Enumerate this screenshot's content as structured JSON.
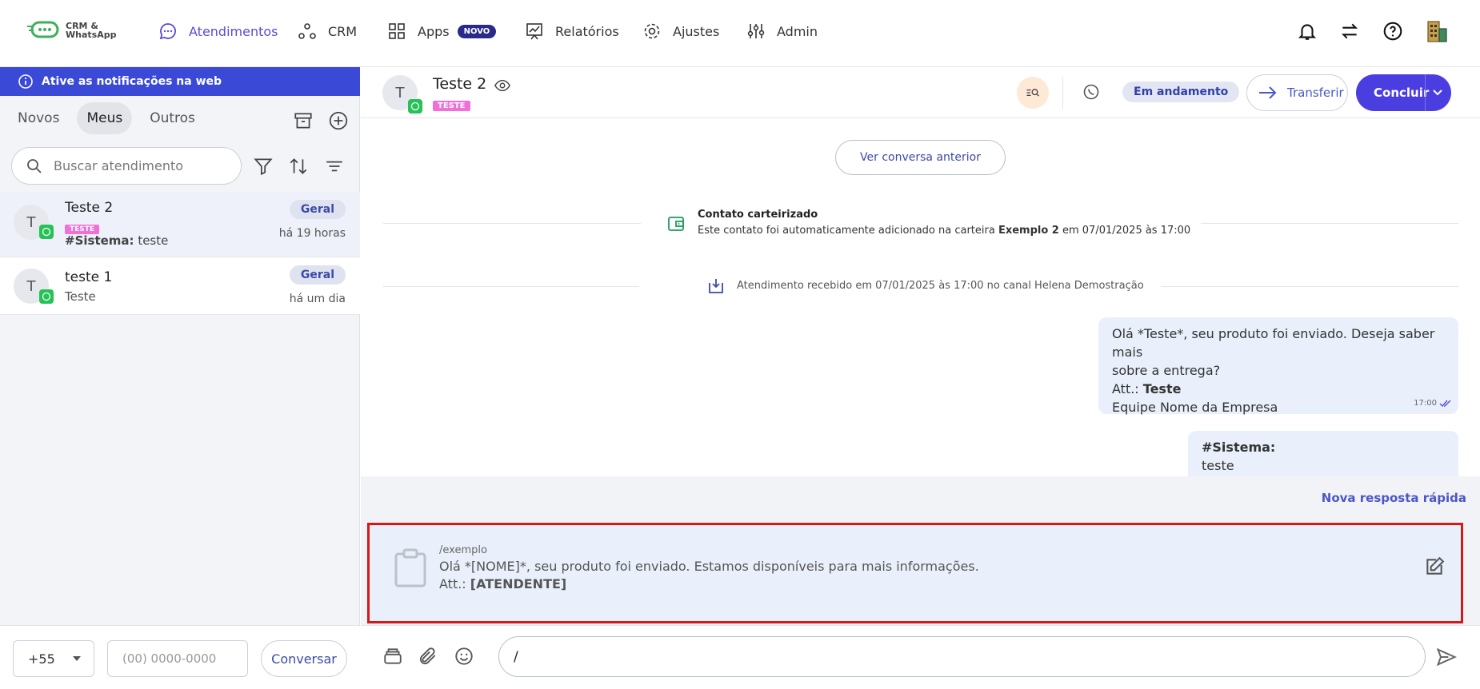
{
  "app": {
    "logo_line1": "CRM &",
    "logo_line2": "WhatsApp"
  },
  "nav": {
    "items": [
      {
        "label": "Atendimentos",
        "icon": "chat-bubble-icon",
        "active": true
      },
      {
        "label": "CRM",
        "icon": "crm-nodes-icon"
      },
      {
        "label": "Apps",
        "icon": "apps-grid-icon",
        "badge": "NOVO"
      },
      {
        "label": "Relatórios",
        "icon": "chart-board-icon"
      },
      {
        "label": "Ajustes",
        "icon": "gear-icon"
      },
      {
        "label": "Admin",
        "icon": "sliders-icon"
      }
    ],
    "right_icons": [
      "bell-icon",
      "transfer-arrows-icon",
      "help-icon",
      "building-icon"
    ]
  },
  "sidebar": {
    "notification": "Ative as notificações na web",
    "tabs": [
      {
        "label": "Novos"
      },
      {
        "label": "Meus",
        "active": true
      },
      {
        "label": "Outros"
      }
    ],
    "search_placeholder": "Buscar atendimento",
    "conversations": [
      {
        "avatar": "T",
        "name": "Teste 2",
        "tag": "TESTE",
        "preview_bold": "#Sistema:",
        "preview": " teste",
        "queue": "Geral",
        "time": "há 19 horas",
        "selected": true
      },
      {
        "avatar": "T",
        "name": "teste 1",
        "preview": "Teste",
        "queue": "Geral",
        "time": "há um dia"
      }
    ],
    "country_code": "+55",
    "phone_placeholder": "(00) 0000-0000",
    "start_button": "Conversar"
  },
  "chat": {
    "contact_avatar": "T",
    "contact_name": "Teste 2",
    "contact_tag": "TESTE",
    "status": "Em andamento",
    "transfer_label": "Transferir",
    "conclude_label": "Concluir",
    "prev_conversation": "Ver conversa anterior",
    "event1_title": "Contato carteirizado",
    "event1_text_a": "Este contato foi automaticamente adicionado na carteira ",
    "event1_text_bold": "Exemplo 2",
    "event1_text_b": " em 07/01/2025 às 17:00",
    "event2_text": "Atendimento recebido em 07/01/2025 às 17:00 no canal Helena Demostração",
    "message1": {
      "line1": "Olá *Teste*, seu produto foi enviado. Deseja saber mais",
      "line2": "sobre a entrega?",
      "line3_a": "Att.: ",
      "line3_bold": "Teste",
      "line4": "Equipe Nome da Empresa",
      "time": "17:00"
    },
    "message2": {
      "bold": "#Sistema:",
      "text": "teste"
    },
    "new_quick_reply": "Nova resposta rápida",
    "quick_reply": {
      "shortcut": "/exemplo",
      "line1": "Olá *[NOME]*, seu produto foi enviado. Estamos disponíveis para mais informações.",
      "line2_a": "Att.: ",
      "line2_bold": "[ATENDENTE]"
    },
    "composer_value": "/"
  }
}
